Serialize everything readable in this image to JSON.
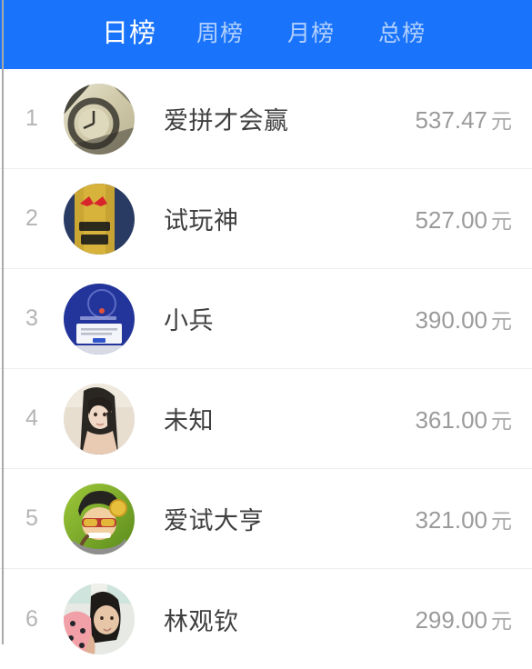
{
  "tabs": [
    {
      "label": "日榜",
      "active": true
    },
    {
      "label": "周榜",
      "active": false
    },
    {
      "label": "月榜",
      "active": false
    },
    {
      "label": "总榜",
      "active": false
    }
  ],
  "colors": {
    "header_blue": "#1a74fb",
    "active_tab_text": "#ffffff",
    "inactive_tab_text": "rgba(255,255,255,0.66)",
    "name_text": "#3f3f3f",
    "amount_text": "#9b9b9b",
    "rank_text": "#b4b4b4",
    "divider": "#ededed",
    "background": "#ffffff"
  },
  "ranking": {
    "rows": [
      {
        "rank": "1",
        "name": "爱拼才会赢",
        "amount": "537.47",
        "unit": "元",
        "avatar": "watch-photo-avatar"
      },
      {
        "rank": "2",
        "name": "试玩神",
        "amount": "527.00",
        "unit": "元",
        "avatar": "redbull-can-avatar"
      },
      {
        "rank": "3",
        "name": "小兵",
        "amount": "390.00",
        "unit": "元",
        "avatar": "blue-dialog-avatar"
      },
      {
        "rank": "4",
        "name": "未知",
        "amount": "361.00",
        "unit": "元",
        "avatar": "woman-portrait-avatar"
      },
      {
        "rank": "5",
        "name": "爱试大亨",
        "amount": "321.00",
        "unit": "元",
        "avatar": "cartoon-man-avatar"
      },
      {
        "rank": "6",
        "name": "林观钦",
        "amount": "299.00",
        "unit": "元",
        "avatar": "child-photo-avatar"
      }
    ]
  }
}
